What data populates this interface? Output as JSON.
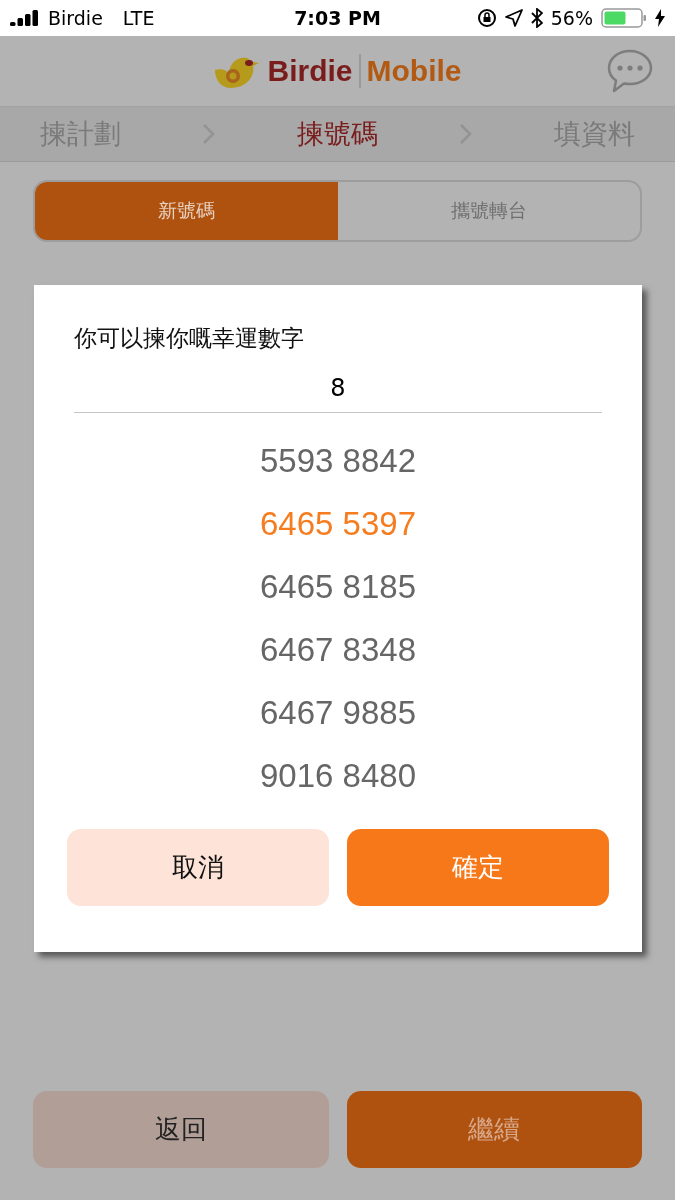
{
  "status_bar": {
    "carrier": "Birdie",
    "network": "LTE",
    "time": "7:03 PM",
    "battery": "56%"
  },
  "header": {
    "logo_primary": "Birdie",
    "logo_secondary": "Mobile"
  },
  "steps": [
    {
      "label": "揀計劃",
      "selected": false
    },
    {
      "label": "揀號碼",
      "selected": true
    },
    {
      "label": "填資料",
      "selected": false
    }
  ],
  "segments": [
    {
      "label": "新號碼",
      "selected": true
    },
    {
      "label": "攜號轉台",
      "selected": false
    }
  ],
  "dialog": {
    "title": "你可以揀你嘅幸運數字",
    "input_value": "8",
    "numbers": [
      {
        "label": "5593 8842",
        "selected": false
      },
      {
        "label": "6465 5397",
        "selected": true
      },
      {
        "label": "6465 8185",
        "selected": false
      },
      {
        "label": "6467 8348",
        "selected": false
      },
      {
        "label": "6467 9885",
        "selected": false
      },
      {
        "label": "9016 8480",
        "selected": false
      }
    ],
    "cancel": "取消",
    "confirm": "確定"
  },
  "footer": {
    "back": "返回",
    "next": "繼續"
  }
}
